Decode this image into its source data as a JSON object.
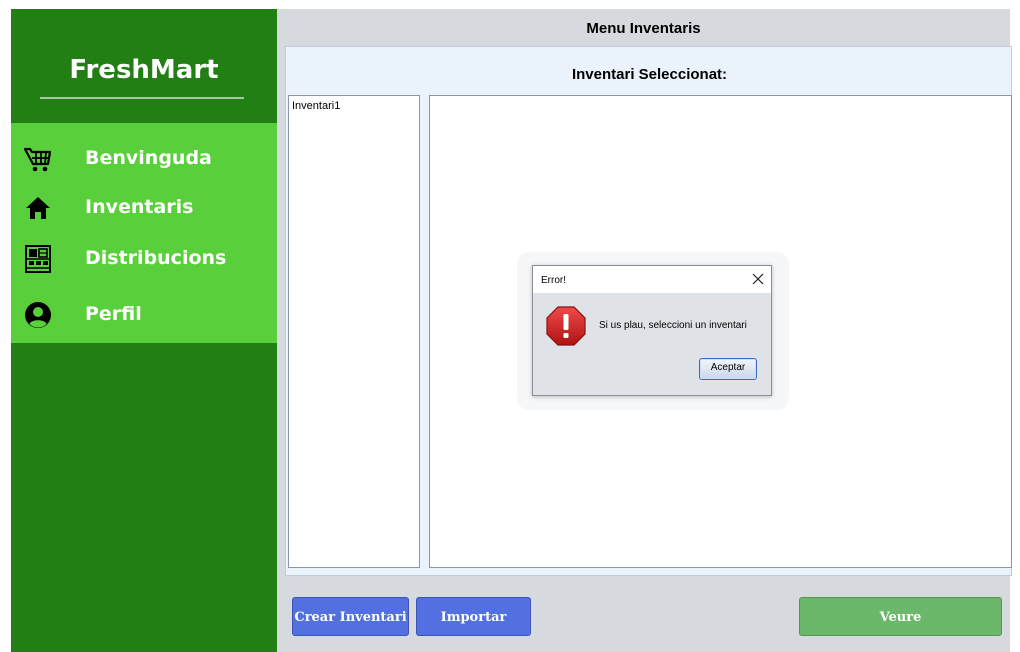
{
  "sidebar": {
    "brand": "FreshMart",
    "items": [
      {
        "label": "Benvinguda",
        "icon": "shopping-cart-icon"
      },
      {
        "label": "Inventaris",
        "icon": "home-icon"
      },
      {
        "label": "Distribucions",
        "icon": "store-icon"
      },
      {
        "label": "Perfil",
        "icon": "user-icon"
      }
    ]
  },
  "main": {
    "title": "Menu Inventaris",
    "content_title": "Inventari Seleccionat:",
    "inventories": [
      "Inventari1"
    ],
    "buttons": {
      "create": "Crear Inventari",
      "import": "Importar",
      "view": "Veure"
    }
  },
  "dialog": {
    "title": "Error!",
    "message": "Si us plau, seleccioni un inventari",
    "ok_label": "Aceptar",
    "icon": "error-stop-icon"
  },
  "colors": {
    "sidebar": "#217f14",
    "menu": "#5acf3c",
    "primary_button": "#5270e0",
    "view_button": "#6cb86a"
  }
}
